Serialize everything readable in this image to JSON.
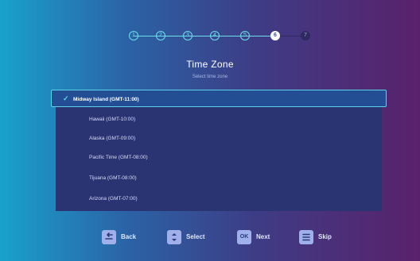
{
  "wizard": {
    "steps": [
      "1",
      "2",
      "3",
      "4",
      "5",
      "6",
      "7"
    ],
    "current_step_index": 5,
    "colors": {
      "done": "#6be0e8",
      "current": "#ffffff",
      "upcoming": "#2f2a60"
    }
  },
  "header": {
    "title": "Time Zone",
    "subtitle": "Select time zone"
  },
  "timezones": {
    "selected_index": 0,
    "items": [
      "Midway Island (GMT-11:00)",
      "Hawaii (GMT-10:00)",
      "Alaska (GMT-09:00)",
      "Pacific Time (GMT-08:00)",
      "Tijuana (GMT-08:00)",
      "Arizona (GMT-07:00)"
    ]
  },
  "controls": {
    "back": {
      "label": "Back",
      "icon": "back-arrow-icon"
    },
    "select": {
      "label": "Select",
      "icon": "up-down-arrows-icon"
    },
    "next": {
      "label": "Next",
      "icon": "ok-icon",
      "glyph": "OK"
    },
    "skip": {
      "label": "Skip",
      "icon": "menu-lines-icon"
    }
  }
}
